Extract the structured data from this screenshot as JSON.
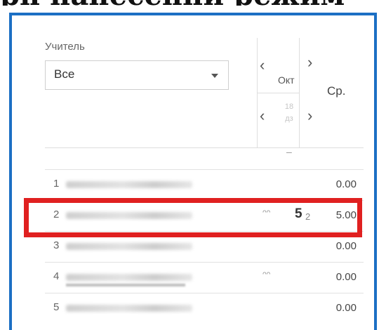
{
  "banner_text": "рп нанесенни режим",
  "filter": {
    "teacher_label": "Учитель",
    "teacher_value": "Все"
  },
  "header": {
    "month": "Окт",
    "date": "18 дз",
    "average": "Ср.",
    "empty_mark": "–"
  },
  "nav": {
    "prev": "‹",
    "next": "›"
  },
  "rows": [
    {
      "num": "1",
      "avg": "0.00"
    },
    {
      "num": "2",
      "avg": "5.00",
      "grade": "5",
      "grade_sub": "2",
      "absent": "ᵔᵔ"
    },
    {
      "num": "3",
      "avg": "0.00"
    },
    {
      "num": "4",
      "avg": "0.00",
      "absent": "ᵔᵔ"
    },
    {
      "num": "5",
      "avg": "0.00"
    }
  ],
  "colors": {
    "frame": "#1c6fc4",
    "highlight": "#e02020"
  }
}
